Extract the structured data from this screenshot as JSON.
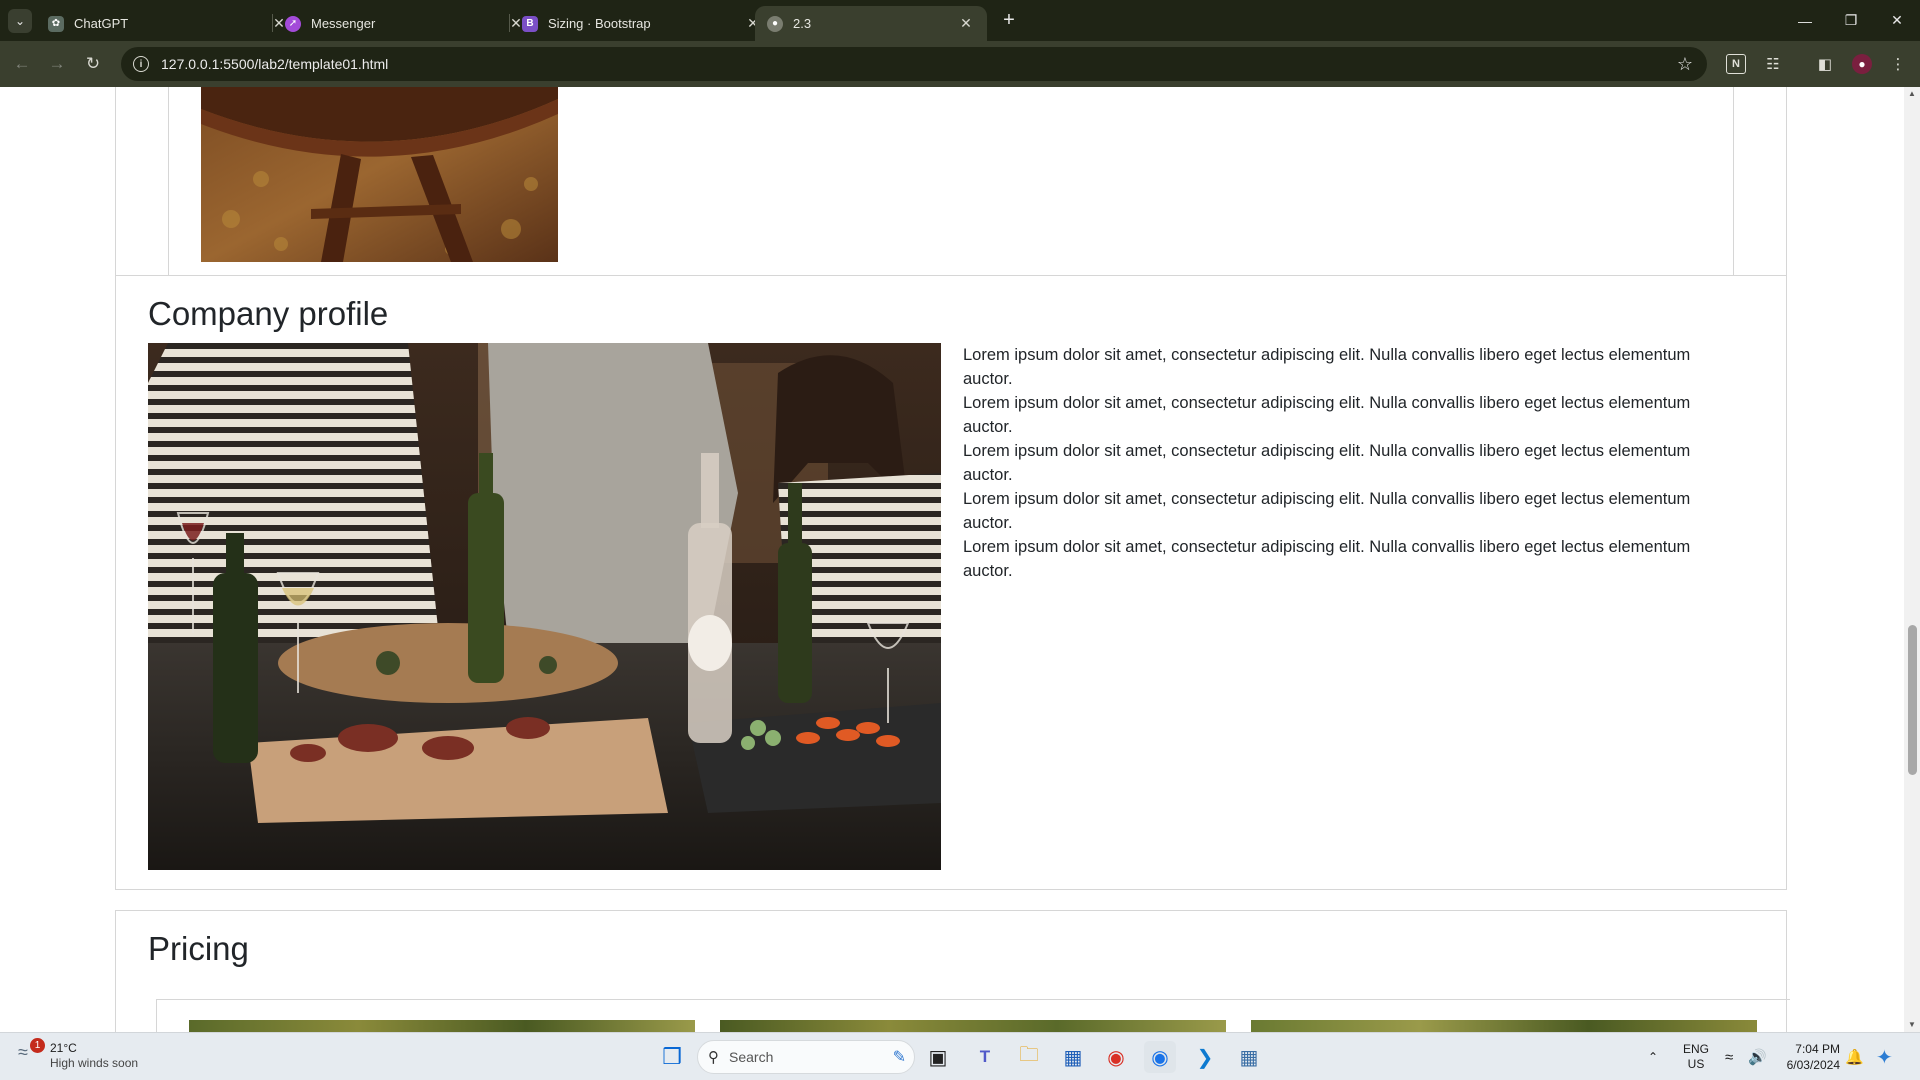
{
  "browser": {
    "tabs": [
      {
        "title": "ChatGPT",
        "favicon": "chatgpt-icon",
        "color": "#5b6b61"
      },
      {
        "title": "Messenger",
        "favicon": "messenger-icon",
        "color": "#a34bd9"
      },
      {
        "title": "Sizing · Bootstrap",
        "favicon": "bootstrap-icon",
        "color": "#7b4fc6"
      },
      {
        "title": "2.3",
        "favicon": "globe-icon",
        "color": "#7a7d70"
      }
    ],
    "url": "127.0.0.1:5500/lab2/template01.html",
    "frame_color": "#1f2415",
    "toolbar_color": "#3a3f2e"
  },
  "page": {
    "company_profile": {
      "title": "Company profile",
      "paragraphs": [
        "Lorem ipsum dolor sit amet, consectetur adipiscing elit. Nulla convallis libero eget lectus elementum auctor.",
        "Lorem ipsum dolor sit amet, consectetur adipiscing elit. Nulla convallis libero eget lectus elementum auctor.",
        "Lorem ipsum dolor sit amet, consectetur adipiscing elit. Nulla convallis libero eget lectus elementum auctor.",
        "Lorem ipsum dolor sit amet, consectetur adipiscing elit. Nulla convallis libero eget lectus elementum auctor.",
        "Lorem ipsum dolor sit amet, consectetur adipiscing elit. Nulla convallis libero eget lectus elementum auctor."
      ]
    },
    "pricing": {
      "title": "Pricing"
    }
  },
  "taskbar": {
    "weather_temp": "21°C",
    "weather_desc": "High winds soon",
    "weather_badge": "1",
    "search_placeholder": "Search",
    "lang_top": "ENG",
    "lang_bottom": "US",
    "time": "7:04 PM",
    "date": "6/03/2024"
  }
}
